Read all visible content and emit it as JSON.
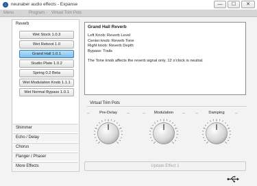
{
  "window": {
    "title": "neunaber audio effects - Expanse",
    "minimize": "—",
    "maximize": "☐",
    "close": "✕"
  },
  "menu": [
    "Menu",
    "Program",
    "Virtual Trim Pots"
  ],
  "sidebar": {
    "active_category": "Reverb",
    "effects": [
      "Wet Stock 1.0.3",
      "Wet Reboot 1.0",
      "Grand Hall 1.0.1",
      "Studio Plate 1.0.2",
      "Spring 0.2 Beta",
      "Wet Modulation Knob 1.1.1",
      "Wet Normal Bypass 1.0.1"
    ],
    "selected_effect": "Grand Hall 1.0.1",
    "other_categories": [
      "Shimmer",
      "Echo / Delay",
      "Chorus",
      "Flanger / Phaser",
      "More Effects"
    ]
  },
  "description": {
    "title": "Grand Hall Reverb",
    "lines": [
      "Left Knob: Reverb Level",
      "Center knob: Reverb Tone",
      "Right knob: Reverb Depth",
      "Bypass: Trails"
    ],
    "note": "The Tone knob affects the reverb signal only. 12 o'clock is neutral."
  },
  "pots": {
    "section_label": "Virtual Trim Pots",
    "knobs": [
      {
        "label": "Pre-Delay",
        "level": 0.5
      },
      {
        "label": "Modulation",
        "level": 0.5
      },
      {
        "label": "Damping",
        "level": 0.5
      }
    ]
  },
  "update_button": "Update Effect 1",
  "icons": {
    "app": "app-icon",
    "connection": "usb-icon"
  },
  "colors": {
    "selected_effect": "#7cc0ee",
    "menubar": "#d5d5d5"
  }
}
